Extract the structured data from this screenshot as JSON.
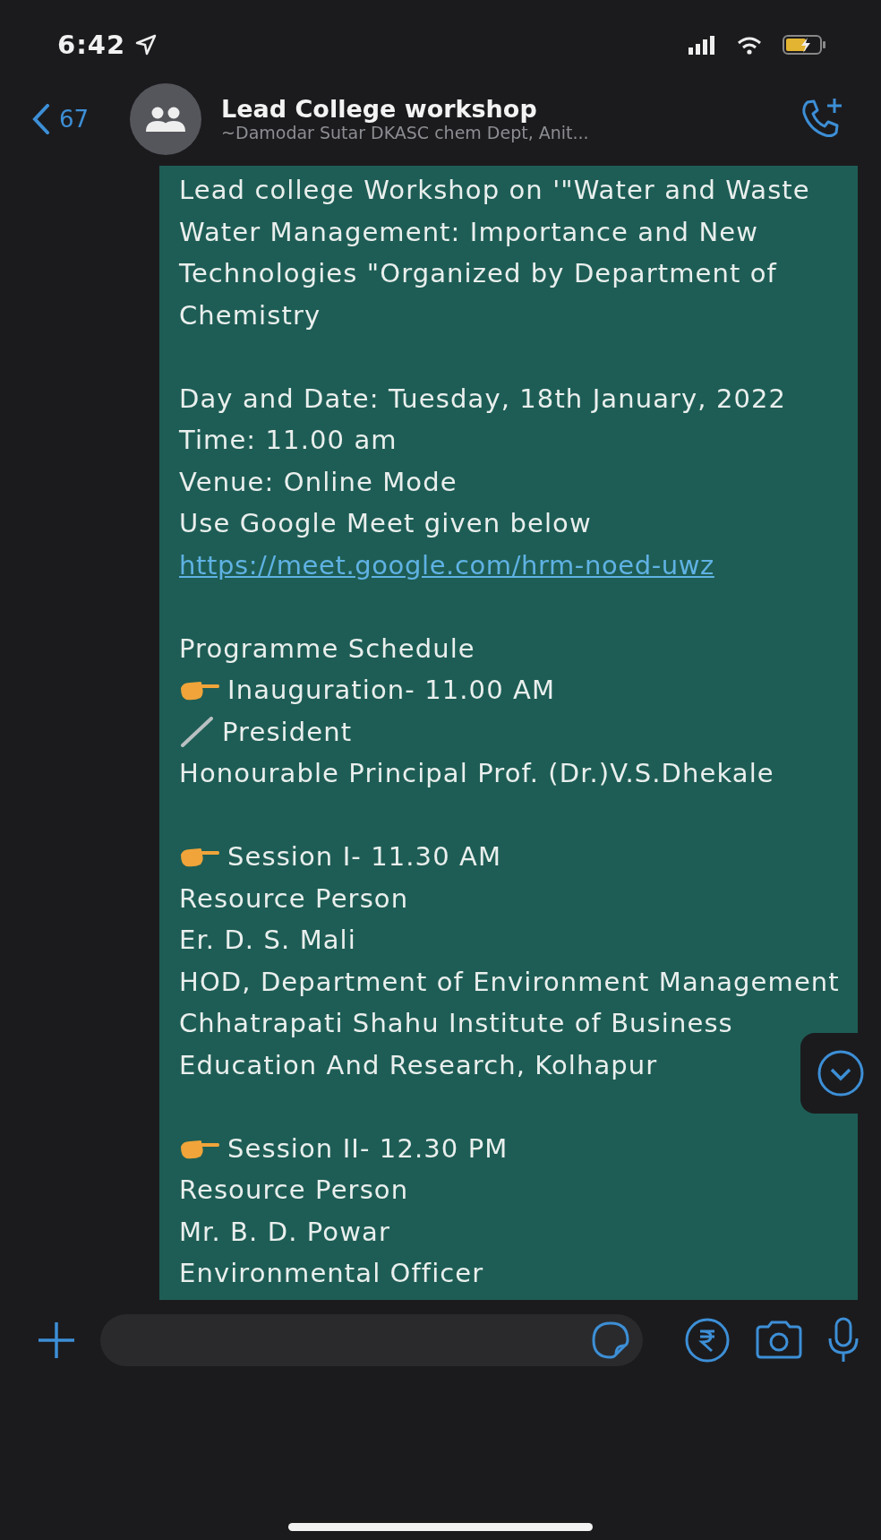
{
  "status_bar": {
    "time": "6:42"
  },
  "header": {
    "back_count": "67",
    "title": "Lead College workshop",
    "subtitle": "~Damodar Sutar DKASC chem Dept, Anit..."
  },
  "message": {
    "blocks": [
      [
        {
          "kind": "text",
          "text": "Lead college Workshop on '\"Water and Waste Water Management: Importance and New Technologies \"Organized by Department of Chemistry"
        }
      ],
      [
        {
          "kind": "text",
          "text": "Day and Date: Tuesday, 18th January, 2022"
        },
        {
          "kind": "text",
          "text": "Time: 11.00 am"
        },
        {
          "kind": "text",
          "text": "Venue: Online Mode"
        },
        {
          "kind": "text",
          "text": "Use Google Meet given below"
        },
        {
          "kind": "link",
          "text": "https://meet.google.com/hrm-noed-uwz"
        }
      ],
      [
        {
          "kind": "text",
          "text": "Programme Schedule"
        },
        {
          "kind": "pointer",
          "text": "Inauguration- 11.00 AM"
        },
        {
          "kind": "pen",
          "text": "President"
        },
        {
          "kind": "text",
          "text": "Honourable Principal Prof. (Dr.)V.S.Dhekale"
        }
      ],
      [
        {
          "kind": "pointer",
          "text": "Session I- 11.30 AM"
        },
        {
          "kind": "text",
          "text": "Resource Person"
        },
        {
          "kind": "text",
          "text": "Er. D. S. Mali"
        },
        {
          "kind": "text",
          "text": "HOD, Department of Environment Management"
        },
        {
          "kind": "text",
          "text": "Chhatrapati Shahu Institute of Business Education And Research, Kolhapur"
        }
      ],
      [
        {
          "kind": "pointer",
          "text": "Session II- 12.30 PM"
        },
        {
          "kind": "text",
          "text": "Resource Person"
        },
        {
          "kind": "text",
          "text": "Mr. B. D. Powar"
        },
        {
          "kind": "text",
          "text": "Environmental Officer"
        }
      ]
    ]
  }
}
